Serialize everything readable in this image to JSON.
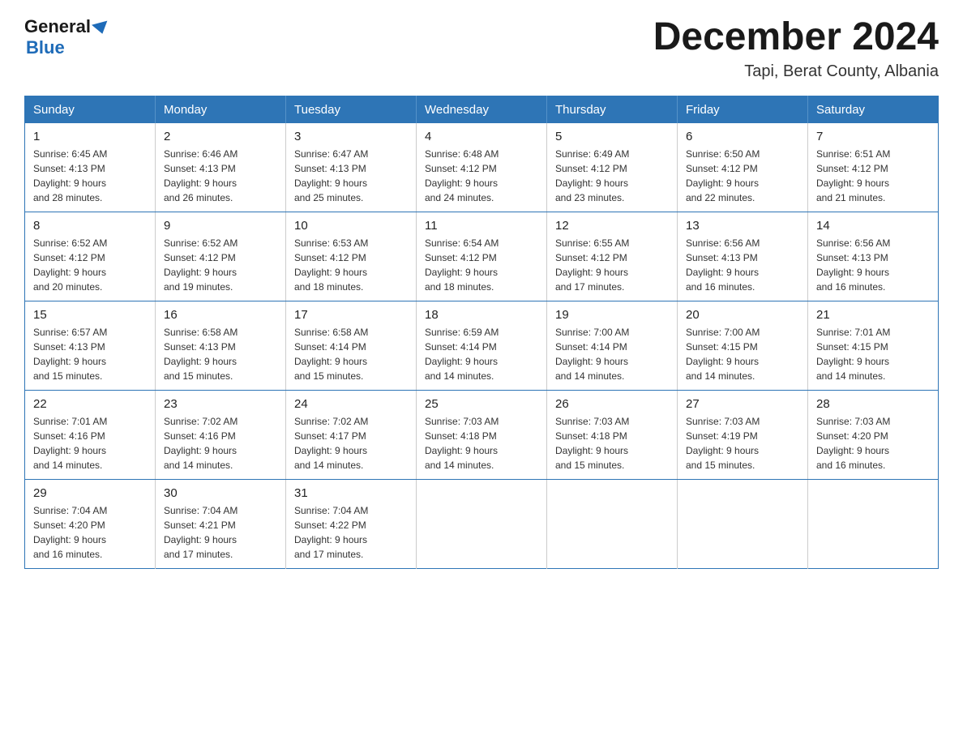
{
  "header": {
    "logo_general": "General",
    "logo_blue": "Blue",
    "title": "December 2024",
    "subtitle": "Tapi, Berat County, Albania"
  },
  "days_of_week": [
    "Sunday",
    "Monday",
    "Tuesday",
    "Wednesday",
    "Thursday",
    "Friday",
    "Saturday"
  ],
  "weeks": [
    [
      {
        "day": "1",
        "sunrise": "6:45 AM",
        "sunset": "4:13 PM",
        "daylight": "9 hours and 28 minutes."
      },
      {
        "day": "2",
        "sunrise": "6:46 AM",
        "sunset": "4:13 PM",
        "daylight": "9 hours and 26 minutes."
      },
      {
        "day": "3",
        "sunrise": "6:47 AM",
        "sunset": "4:13 PM",
        "daylight": "9 hours and 25 minutes."
      },
      {
        "day": "4",
        "sunrise": "6:48 AM",
        "sunset": "4:12 PM",
        "daylight": "9 hours and 24 minutes."
      },
      {
        "day": "5",
        "sunrise": "6:49 AM",
        "sunset": "4:12 PM",
        "daylight": "9 hours and 23 minutes."
      },
      {
        "day": "6",
        "sunrise": "6:50 AM",
        "sunset": "4:12 PM",
        "daylight": "9 hours and 22 minutes."
      },
      {
        "day": "7",
        "sunrise": "6:51 AM",
        "sunset": "4:12 PM",
        "daylight": "9 hours and 21 minutes."
      }
    ],
    [
      {
        "day": "8",
        "sunrise": "6:52 AM",
        "sunset": "4:12 PM",
        "daylight": "9 hours and 20 minutes."
      },
      {
        "day": "9",
        "sunrise": "6:52 AM",
        "sunset": "4:12 PM",
        "daylight": "9 hours and 19 minutes."
      },
      {
        "day": "10",
        "sunrise": "6:53 AM",
        "sunset": "4:12 PM",
        "daylight": "9 hours and 18 minutes."
      },
      {
        "day": "11",
        "sunrise": "6:54 AM",
        "sunset": "4:12 PM",
        "daylight": "9 hours and 18 minutes."
      },
      {
        "day": "12",
        "sunrise": "6:55 AM",
        "sunset": "4:12 PM",
        "daylight": "9 hours and 17 minutes."
      },
      {
        "day": "13",
        "sunrise": "6:56 AM",
        "sunset": "4:13 PM",
        "daylight": "9 hours and 16 minutes."
      },
      {
        "day": "14",
        "sunrise": "6:56 AM",
        "sunset": "4:13 PM",
        "daylight": "9 hours and 16 minutes."
      }
    ],
    [
      {
        "day": "15",
        "sunrise": "6:57 AM",
        "sunset": "4:13 PM",
        "daylight": "9 hours and 15 minutes."
      },
      {
        "day": "16",
        "sunrise": "6:58 AM",
        "sunset": "4:13 PM",
        "daylight": "9 hours and 15 minutes."
      },
      {
        "day": "17",
        "sunrise": "6:58 AM",
        "sunset": "4:14 PM",
        "daylight": "9 hours and 15 minutes."
      },
      {
        "day": "18",
        "sunrise": "6:59 AM",
        "sunset": "4:14 PM",
        "daylight": "9 hours and 14 minutes."
      },
      {
        "day": "19",
        "sunrise": "7:00 AM",
        "sunset": "4:14 PM",
        "daylight": "9 hours and 14 minutes."
      },
      {
        "day": "20",
        "sunrise": "7:00 AM",
        "sunset": "4:15 PM",
        "daylight": "9 hours and 14 minutes."
      },
      {
        "day": "21",
        "sunrise": "7:01 AM",
        "sunset": "4:15 PM",
        "daylight": "9 hours and 14 minutes."
      }
    ],
    [
      {
        "day": "22",
        "sunrise": "7:01 AM",
        "sunset": "4:16 PM",
        "daylight": "9 hours and 14 minutes."
      },
      {
        "day": "23",
        "sunrise": "7:02 AM",
        "sunset": "4:16 PM",
        "daylight": "9 hours and 14 minutes."
      },
      {
        "day": "24",
        "sunrise": "7:02 AM",
        "sunset": "4:17 PM",
        "daylight": "9 hours and 14 minutes."
      },
      {
        "day": "25",
        "sunrise": "7:03 AM",
        "sunset": "4:18 PM",
        "daylight": "9 hours and 14 minutes."
      },
      {
        "day": "26",
        "sunrise": "7:03 AM",
        "sunset": "4:18 PM",
        "daylight": "9 hours and 15 minutes."
      },
      {
        "day": "27",
        "sunrise": "7:03 AM",
        "sunset": "4:19 PM",
        "daylight": "9 hours and 15 minutes."
      },
      {
        "day": "28",
        "sunrise": "7:03 AM",
        "sunset": "4:20 PM",
        "daylight": "9 hours and 16 minutes."
      }
    ],
    [
      {
        "day": "29",
        "sunrise": "7:04 AM",
        "sunset": "4:20 PM",
        "daylight": "9 hours and 16 minutes."
      },
      {
        "day": "30",
        "sunrise": "7:04 AM",
        "sunset": "4:21 PM",
        "daylight": "9 hours and 17 minutes."
      },
      {
        "day": "31",
        "sunrise": "7:04 AM",
        "sunset": "4:22 PM",
        "daylight": "9 hours and 17 minutes."
      },
      null,
      null,
      null,
      null
    ]
  ],
  "labels": {
    "sunrise": "Sunrise: ",
    "sunset": "Sunset: ",
    "daylight": "Daylight: "
  }
}
